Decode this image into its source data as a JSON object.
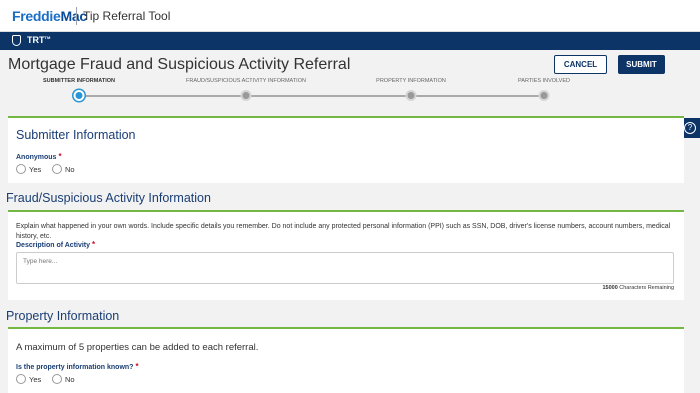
{
  "header": {
    "logo_part1": "Freddie",
    "logo_part2": "Mac",
    "app_title": "Tip Referral Tool"
  },
  "navbar": {
    "label": "TRT"
  },
  "page": {
    "title": "Mortgage Fraud and Suspicious Activity Referral",
    "cancel_label": "CANCEL",
    "submit_label": "SUBMIT"
  },
  "stepper": {
    "steps": [
      {
        "label": "SUBMITTER INFORMATION",
        "active": true
      },
      {
        "label": "FRAUD/SUSPICIOUS ACTIVITY INFORMATION",
        "active": false
      },
      {
        "label": "PROPERTY INFORMATION",
        "active": false
      },
      {
        "label": "PARTIES INVOLVED",
        "active": false
      }
    ]
  },
  "submitter": {
    "heading": "Submitter Information",
    "anonymous_label": "Anonymous",
    "required_mark": "*",
    "yes_label": "Yes",
    "no_label": "No"
  },
  "fraud": {
    "heading": "Fraud/Suspicious Activity Information",
    "instructions": "Explain what happened in your own words. Include specific details you remember. Do not include any protected personal information (PPI) such as SSN, DOB, driver's license numbers, account numbers, medical history, etc.",
    "description_label": "Description of Activity",
    "required_mark": "*",
    "placeholder": "Type here...",
    "char_count": "15000",
    "char_suffix": "Characters Remaining"
  },
  "property": {
    "heading": "Property Information",
    "max_note": "A maximum of 5 properties can be added to each referral.",
    "known_label": "Is the property information known?",
    "required_mark": "*",
    "yes_label": "Yes",
    "no_label": "No"
  },
  "help": {
    "icon_glyph": "?"
  },
  "colors": {
    "navy": "#0c3466",
    "accent_green": "#74b843",
    "step_active": "#2896d4",
    "heading_blue": "#1a3e74"
  }
}
